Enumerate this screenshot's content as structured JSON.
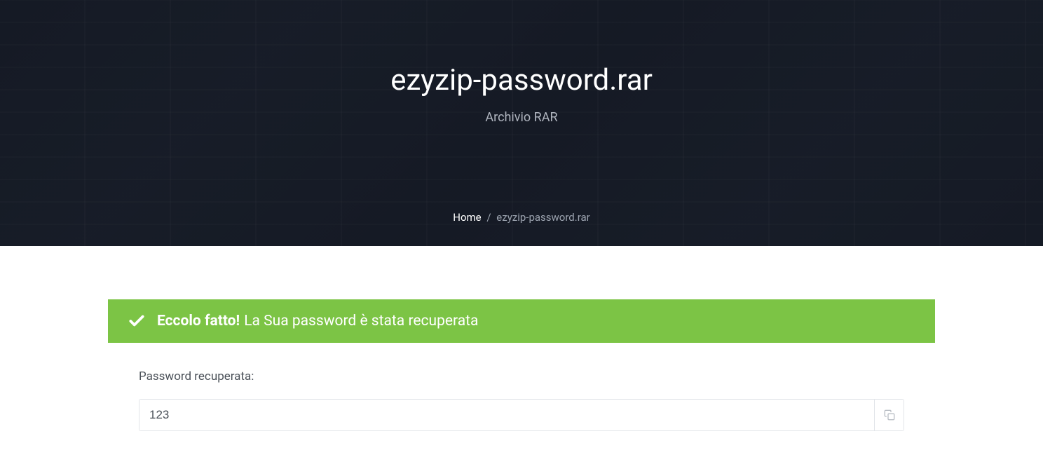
{
  "hero": {
    "title": "ezyzip-password.rar",
    "subtitle": "Archivio RAR"
  },
  "breadcrumb": {
    "home": "Home",
    "separator": "/",
    "current": "ezyzip-password.rar"
  },
  "success": {
    "strong": "Eccolo fatto!",
    "text": "La Sua password è stata recuperata"
  },
  "result": {
    "label": "Password recuperata:",
    "value": "123"
  }
}
